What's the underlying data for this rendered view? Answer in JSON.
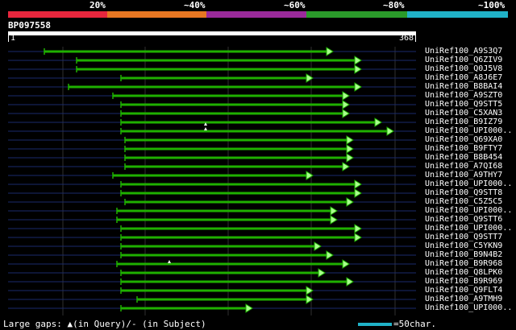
{
  "percent_labels": [
    "20%",
    "~40%",
    "~60%",
    "~80%",
    "~100%"
  ],
  "colors": {
    "legend": [
      "#e8263d",
      "#e87722",
      "#9b2a9b",
      "#2a9b2a",
      "#20b2c8"
    ],
    "hit_line": "#1fb000",
    "hit_arrow": "#a8ff8c",
    "tail": "#1a2a6b",
    "grid": "#303030"
  },
  "query": {
    "name": "BP097558",
    "start": "1",
    "end": "368",
    "length": 368
  },
  "hits": [
    {
      "label": "UniRef100_A9S3Q7",
      "start": 55,
      "end": 410,
      "gaps": []
    },
    {
      "label": "UniRef100_Q6ZIV9",
      "start": 95,
      "end": 445,
      "gaps": []
    },
    {
      "label": "UniRef100_Q0J5V8",
      "start": 95,
      "end": 445,
      "gaps": []
    },
    {
      "label": "UniRef100_A8J6E7",
      "start": 150,
      "end": 385,
      "gaps": []
    },
    {
      "label": "UniRef100_B8BAI4",
      "start": 85,
      "end": 445,
      "gaps": []
    },
    {
      "label": "UniRef100_A9SZT0",
      "start": 140,
      "end": 430,
      "gaps": []
    },
    {
      "label": "UniRef100_Q9STT5",
      "start": 150,
      "end": 430,
      "gaps": []
    },
    {
      "label": "UniRef100_C5XAN3",
      "start": 150,
      "end": 430,
      "gaps": []
    },
    {
      "label": "UniRef100_B9IZ79",
      "start": 150,
      "end": 470,
      "gaps": []
    },
    {
      "label": "UniRef100_UPI000..",
      "start": 150,
      "end": 485,
      "gaps": [
        {
          "pos": 255,
          "type": "query"
        },
        {
          "pos": 255,
          "type": "query"
        }
      ]
    },
    {
      "label": "UniRef100_Q69XA0",
      "start": 155,
      "end": 435,
      "gaps": []
    },
    {
      "label": "UniRef100_B9FTY7",
      "start": 155,
      "end": 435,
      "gaps": []
    },
    {
      "label": "UniRef100_B8B454",
      "start": 155,
      "end": 435,
      "gaps": []
    },
    {
      "label": "UniRef100_A7QI68",
      "start": 155,
      "end": 430,
      "gaps": []
    },
    {
      "label": "UniRef100_A9THY7",
      "start": 140,
      "end": 385,
      "gaps": []
    },
    {
      "label": "UniRef100_UPI000..",
      "start": 150,
      "end": 445,
      "gaps": []
    },
    {
      "label": "UniRef100_Q9STT8",
      "start": 150,
      "end": 445,
      "gaps": []
    },
    {
      "label": "UniRef100_C5Z5C5",
      "start": 155,
      "end": 435,
      "gaps": []
    },
    {
      "label": "UniRef100_UPI000..",
      "start": 145,
      "end": 415,
      "gaps": []
    },
    {
      "label": "UniRef100_Q9STT6",
      "start": 145,
      "end": 415,
      "gaps": []
    },
    {
      "label": "UniRef100_UPI000..",
      "start": 150,
      "end": 445,
      "gaps": []
    },
    {
      "label": "UniRef100_Q9STT7",
      "start": 150,
      "end": 445,
      "gaps": []
    },
    {
      "label": "UniRef100_C5YKN9",
      "start": 150,
      "end": 395,
      "gaps": []
    },
    {
      "label": "UniRef100_B9N4B2",
      "start": 150,
      "end": 410,
      "gaps": []
    },
    {
      "label": "UniRef100_B9R968",
      "start": 145,
      "end": 430,
      "gaps": [
        {
          "pos": 210,
          "type": "query"
        }
      ]
    },
    {
      "label": "UniRef100_Q8LPK0",
      "start": 150,
      "end": 400,
      "gaps": []
    },
    {
      "label": "UniRef100_B9R969",
      "start": 150,
      "end": 435,
      "gaps": []
    },
    {
      "label": "UniRef100_Q9FLT4",
      "start": 150,
      "end": 385,
      "gaps": []
    },
    {
      "label": "UniRef100_A9TMH9",
      "start": 170,
      "end": 385,
      "gaps": []
    },
    {
      "label": "UniRef100_UPI000..",
      "start": 150,
      "end": 310,
      "gaps": []
    }
  ],
  "footer": {
    "gaps_note": "Large gaps: ▲(in Query)/- (in Subject)",
    "scale_note": "=50char."
  }
}
